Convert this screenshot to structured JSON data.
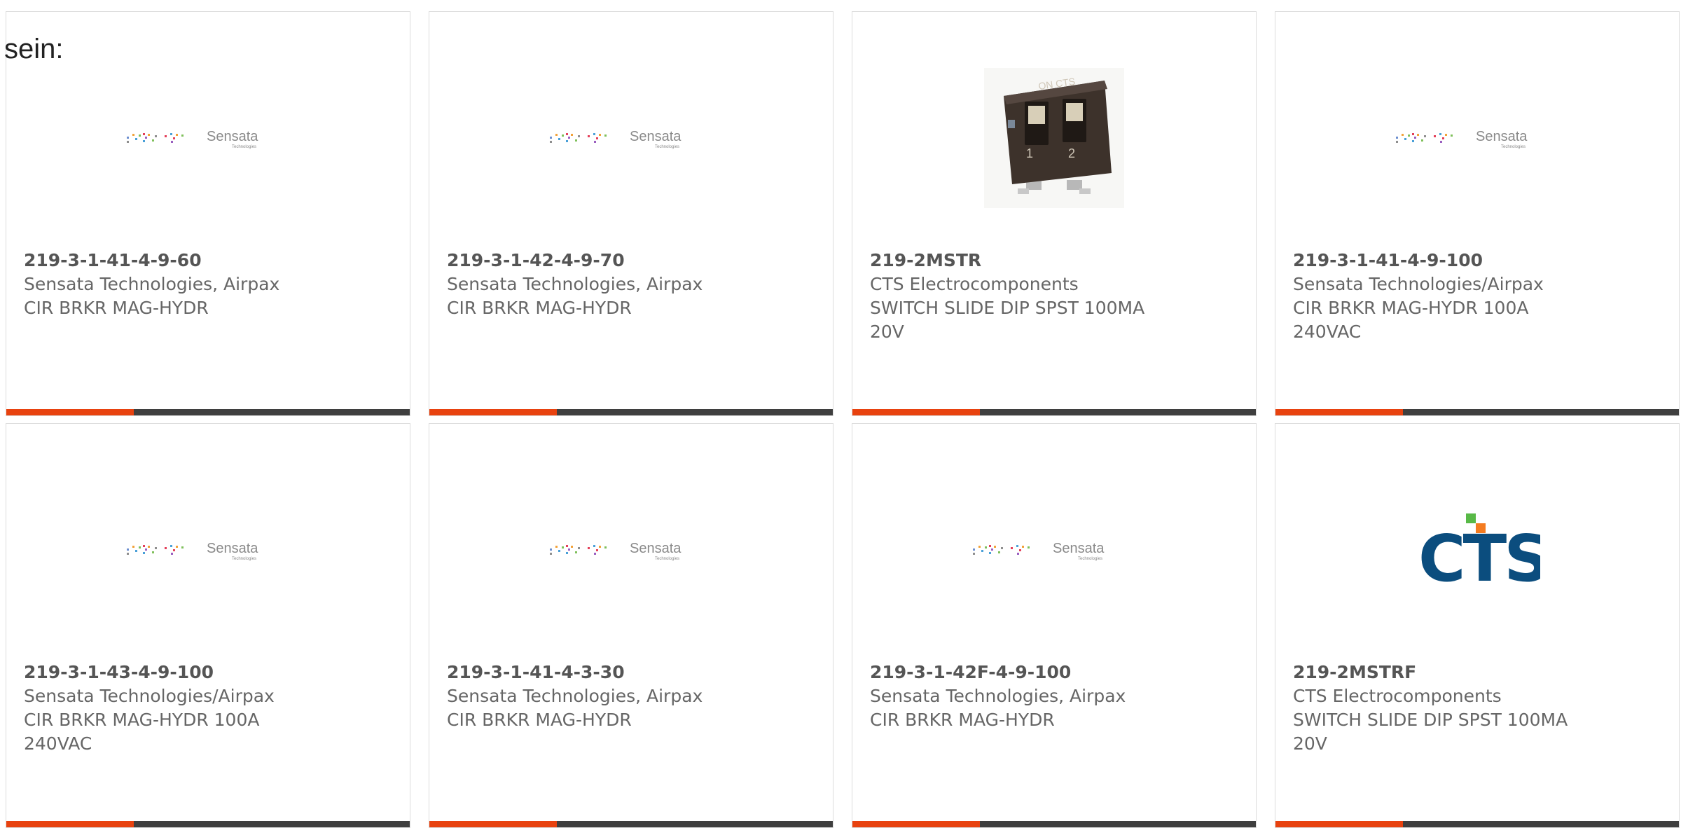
{
  "intro_text": "sein:",
  "colors": {
    "accent_bar": "#e8420f",
    "dark_bar": "#3f3f3f",
    "cts_blue": "#0b4d7e",
    "cts_green": "#58b947",
    "cts_orange": "#f47b20"
  },
  "logos": {
    "sensata_name": "Sensata",
    "sensata_sub": "Technologies",
    "cts_name": "CTS",
    "switch_top_label": "ON CTS",
    "switch_pos1": "1",
    "switch_pos2": "2"
  },
  "products": [
    {
      "part_number": "219-3-1-41-4-9-60",
      "manufacturer": "Sensata Technologies, Airpax",
      "description": "CIR BRKR MAG-HYDR",
      "image": "sensata-logo"
    },
    {
      "part_number": "219-3-1-42-4-9-70",
      "manufacturer": "Sensata Technologies, Airpax",
      "description": "CIR BRKR MAG-HYDR",
      "image": "sensata-logo"
    },
    {
      "part_number": "219-2MSTR",
      "manufacturer": "CTS Electrocomponents",
      "description": "SWITCH SLIDE DIP SPST 100MA 20V",
      "image": "dip-switch-photo"
    },
    {
      "part_number": "219-3-1-41-4-9-100",
      "manufacturer": "Sensata Technologies/Airpax",
      "description": "CIR BRKR MAG-HYDR 100A 240VAC",
      "image": "sensata-logo"
    },
    {
      "part_number": "219-3-1-43-4-9-100",
      "manufacturer": "Sensata Technologies/Airpax",
      "description": "CIR BRKR MAG-HYDR 100A 240VAC",
      "image": "sensata-logo"
    },
    {
      "part_number": "219-3-1-41-4-3-30",
      "manufacturer": "Sensata Technologies, Airpax",
      "description": "CIR BRKR MAG-HYDR",
      "image": "sensata-logo"
    },
    {
      "part_number": "219-3-1-42F-4-9-100",
      "manufacturer": "Sensata Technologies, Airpax",
      "description": "CIR BRKR MAG-HYDR",
      "image": "sensata-logo"
    },
    {
      "part_number": "219-2MSTRF",
      "manufacturer": "CTS Electrocomponents",
      "description": "SWITCH SLIDE DIP SPST 100MA 20V",
      "image": "cts-logo"
    }
  ]
}
